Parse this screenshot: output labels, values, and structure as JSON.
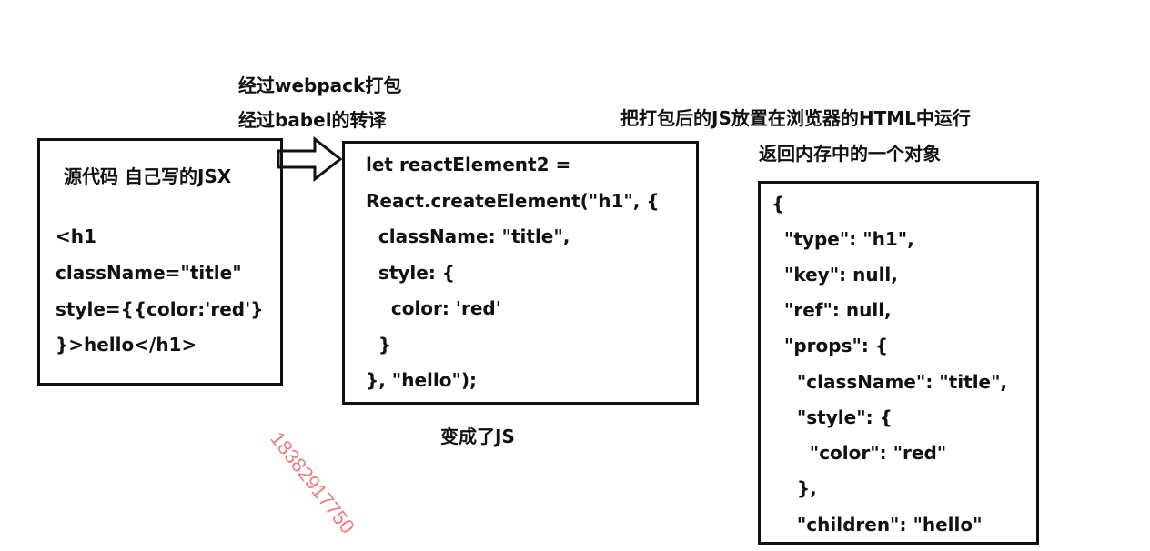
{
  "annotations": {
    "webpack": "经过webpack打包",
    "babel": "经过babel的转译",
    "run_in_browser": "把打包后的JS放置在浏览器的HTML中运行",
    "return_object": "返回内存中的一个对象",
    "became_js": "变成了JS"
  },
  "source_box": {
    "title": "源代码 自己写的JSX",
    "lines": [
      "<h1",
      "className=\"title\"",
      "style={{color:'red'}",
      "}>hello</h1>"
    ]
  },
  "compiled_box": {
    "lines": [
      "let reactElement2 =",
      "React.createElement(\"h1\", {",
      "  className: \"title\",",
      "  style: {",
      "    color: 'red'",
      "  }",
      "}, \"hello\");"
    ]
  },
  "object_box": {
    "lines": [
      "{",
      "  \"type\": \"h1\",",
      "  \"key\": null,",
      "  \"ref\": null,",
      "  \"props\": {",
      "    \"className\": \"title\",",
      "    \"style\": {",
      "      \"color\": \"red\"",
      "    },",
      "    \"children\": \"hello\""
    ]
  },
  "watermark": "18382917750",
  "colors": {
    "stroke": "#111111",
    "watermark": "#ee7d7d"
  },
  "icons": [
    "right-arrow-icon"
  ]
}
